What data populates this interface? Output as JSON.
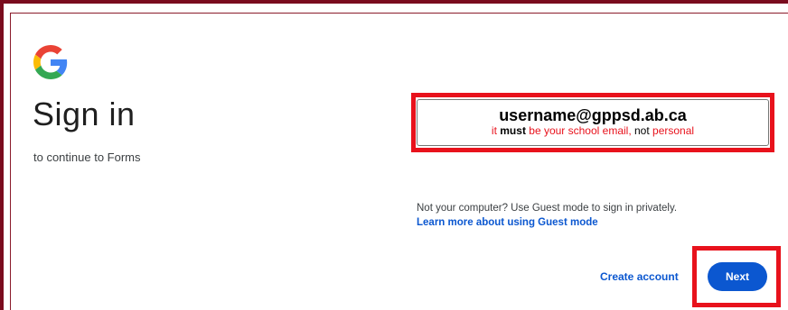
{
  "brand": {
    "logo_icon": "google-g-icon",
    "colors": {
      "blue": "#4285f4",
      "red": "#ea4335",
      "yellow": "#fbbc05",
      "green": "#34a853"
    }
  },
  "header": {
    "title": "Sign in",
    "subtitle": "to continue to Forms"
  },
  "email_field": {
    "value": "username@gppsd.ab.ca",
    "note_part1": "it ",
    "note_bold": "must",
    "note_part2": " be your school email, ",
    "note_not": "not",
    "note_part3": " personal"
  },
  "guest": {
    "text": "Not your computer? Use Guest mode to sign in privately.",
    "link_label": "Learn more about using Guest mode"
  },
  "actions": {
    "create_account_label": "Create account",
    "next_label": "Next"
  },
  "colors": {
    "accent": "#0b57d0",
    "highlight": "#e8121c",
    "frame": "#7a0c1e"
  }
}
